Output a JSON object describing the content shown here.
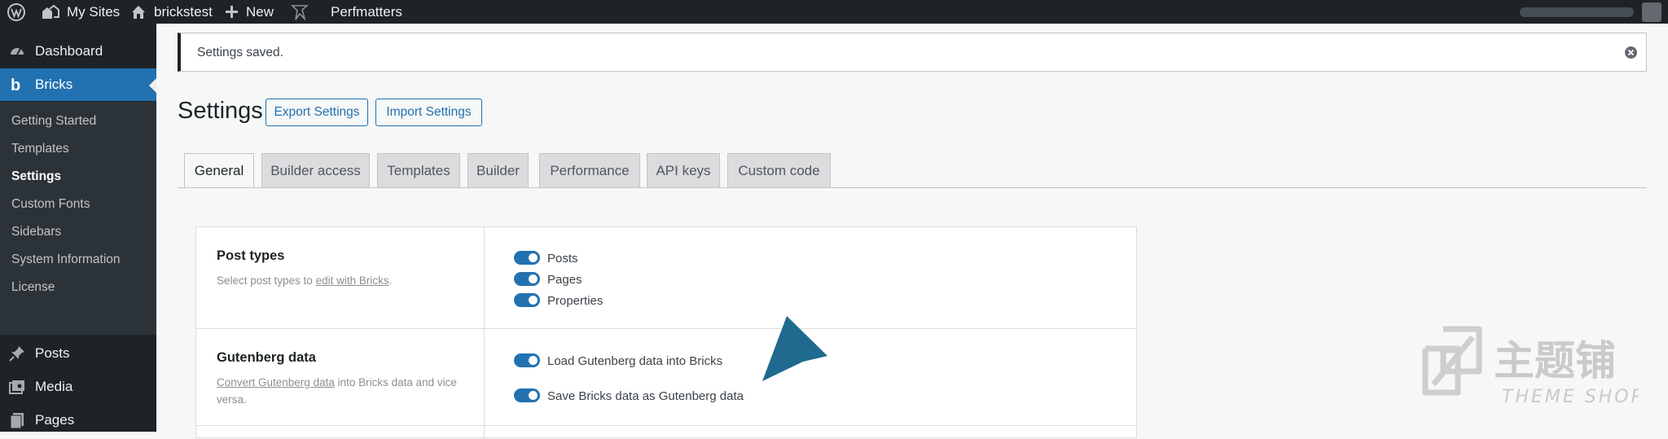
{
  "adminbar": {
    "my_sites": "My Sites",
    "site_name": "brickstest",
    "new": "New",
    "perfmatters": "Perfmatters"
  },
  "sidebar": {
    "items": [
      {
        "label": "Dashboard",
        "icon": "dashboard-icon"
      },
      {
        "label": "Bricks",
        "icon": "bricks-icon"
      }
    ],
    "submenu": [
      "Getting Started",
      "Templates",
      "Settings",
      "Custom Fonts",
      "Sidebars",
      "System Information",
      "License"
    ],
    "lower": [
      {
        "label": "Posts",
        "icon": "pin-icon"
      },
      {
        "label": "Media",
        "icon": "media-icon"
      },
      {
        "label": "Pages",
        "icon": "pages-icon"
      }
    ]
  },
  "notice": {
    "text": "Settings saved."
  },
  "header": {
    "title": "Settings",
    "export": "Export Settings",
    "import": "Import Settings"
  },
  "tabs": [
    "General",
    "Builder access",
    "Templates",
    "Builder",
    "Performance",
    "API keys",
    "Custom code"
  ],
  "settings": {
    "post_types": {
      "title": "Post types",
      "desc_before": "Select post types to ",
      "desc_link": "edit with Bricks",
      "desc_after": ".",
      "options": [
        "Posts",
        "Pages",
        "Properties"
      ]
    },
    "gutenberg": {
      "title": "Gutenberg data",
      "desc_link": "Convert Gutenberg data",
      "desc_after": " into Bricks data and vice versa.",
      "options": [
        "Load Gutenberg data into Bricks",
        "Save Bricks data as Gutenberg data"
      ]
    }
  },
  "watermark": {
    "cn": "主题铺",
    "en": "THEME SHOP"
  },
  "colors": {
    "admin_dark": "#1d2327",
    "primary": "#2271b1",
    "submenu_bg": "#2c3338"
  }
}
